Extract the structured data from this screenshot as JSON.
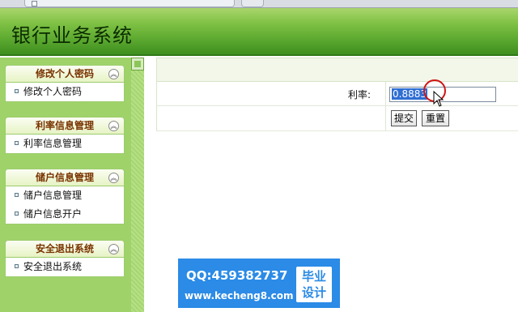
{
  "header": {
    "title": "银行业务系统"
  },
  "sidebar": {
    "panels": [
      {
        "title": "修改个人密码",
        "items": [
          "修改个人密码"
        ]
      },
      {
        "title": "利率信息管理",
        "items": [
          "利率信息管理"
        ]
      },
      {
        "title": "储户信息管理",
        "items": [
          "储户信息管理",
          "储户信息开户"
        ]
      },
      {
        "title": "安全退出系统",
        "items": [
          "安全退出系统"
        ]
      }
    ]
  },
  "form": {
    "rate_label": "利率:",
    "rate_value": "0.8883",
    "submit_label": "提交",
    "reset_label": "重置"
  },
  "watermark": {
    "qq": "QQ:459382737",
    "url": "www.kecheng8.com",
    "badge_line1": "毕业",
    "badge_line2": "设计"
  },
  "colors": {
    "header_green": "#5aa72f",
    "sidebar_green": "#9fd36a",
    "selection_blue": "#2f6ed3",
    "watermark_blue": "#2b8be6"
  }
}
